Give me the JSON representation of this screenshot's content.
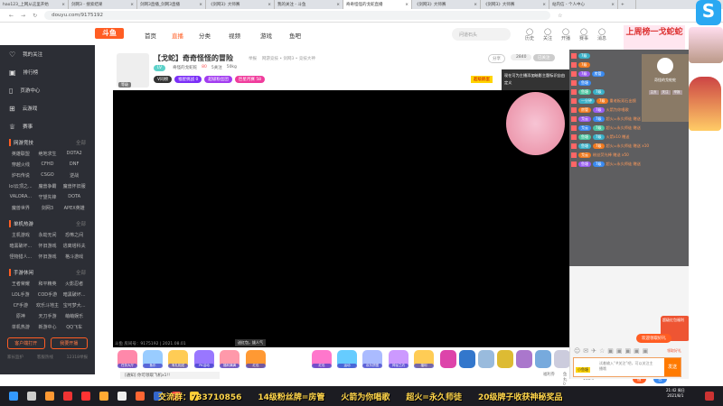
{
  "browser": {
    "tabs": [
      "hao123_上网从这里开始",
      "剑网3 - 搜索结果",
      "剑网3直播_剑网3直播",
      "《剑网3》大师赛",
      "我的关注 - 斗鱼",
      "奇奇怪怪的戈蛇直播",
      "《剑网3》大师赛",
      "《剑网3》大师赛",
      "站内信 - 个人中心"
    ],
    "new_tab": "+",
    "url": "douyu.com/9175192"
  },
  "site": {
    "logo": "斗鱼",
    "nav": [
      "首页",
      "直播",
      "分类",
      "视频",
      "游戏",
      "鱼吧"
    ],
    "search_placeholder": "问道石头",
    "top_icons": [
      "历史",
      "关注",
      "开播",
      "赛事",
      "消息"
    ]
  },
  "sidebar": {
    "items": [
      "我的关注",
      "排行榜",
      "页游中心",
      "云游戏",
      "赛事"
    ],
    "sections": [
      {
        "title": "网游竞技",
        "more": "全部",
        "games": [
          "英雄联盟",
          "绝地求生",
          "DOTA2",
          "穿越火线",
          "CFHD",
          "DNF",
          "炉石传说",
          "CSGO",
          "逆战",
          "lol云顶之...",
          "魔兽争霸",
          "魔兽怀旧服",
          "VALORA...",
          "守望先锋",
          "DOTA",
          "魔兽世界",
          "剑网3",
          "APEX英雄"
        ]
      },
      {
        "title": "单机热游",
        "more": "全部",
        "games": [
          "主机游戏",
          "永劫无间",
          "恐怖之间",
          "暗黑破坏...",
          "怀旧游戏",
          "逃离塔科夫",
          "怪物猎人...",
          "怀旧游戏",
          "格斗游戏"
        ]
      },
      {
        "title": "手游休闲",
        "more": "全部",
        "games": [
          "王者荣耀",
          "和平精英",
          "火影忍者",
          "LOL手游",
          "COD手游",
          "暗黑破坏...",
          "CF手游",
          "欢乐斗地主",
          "宝可梦大...",
          "原神",
          "天刀手游",
          "萌萌娱乐",
          "单机热游",
          "新游中心",
          "QQ飞车"
        ]
      }
    ],
    "buttons": [
      "客户端打开",
      "我要开播"
    ],
    "footer": [
      "家长监护",
      "客服热线",
      "12318举报"
    ]
  },
  "room": {
    "title": "【戈蛇】奇奇怪怪的冒险",
    "tag": "举报",
    "category": "网游竞技 • 剑网3 • 竞技大神",
    "level": "LV",
    "streamer": "奇怪的戈蛇蛇",
    "heat": "80",
    "followers": "5关注",
    "weight": "50kg",
    "avatar_label": "等级",
    "pills": [
      "V同榜",
      "福星挑战 0",
      "超级粉丝团",
      "巨星月赛 58"
    ],
    "share": "分享",
    "follow_count": "2840",
    "follow_btn": "已关注",
    "badge": "超级鹅蛋",
    "tooltip": "现在可为主播添加暗影主题标识自由定义"
  },
  "video": {
    "watermark": "斗鱼 房间号：9175192 | 2021.08.01"
  },
  "gifts": {
    "tooltip": "送红包，拔人气",
    "items": [
      "任务大厅",
      "鱼乐",
      "有礼相送",
      "PK活动",
      "福利满满",
      "红包",
      "红包",
      "运动",
      "欢乐拼图",
      "神龙之约",
      "福利"
    ],
    "notice": "[通知] 你可领取飞机x1!!",
    "stats": [
      "福利券",
      "鱼丸 0",
      "鱼翅 148.9"
    ],
    "recharge": "充值",
    "backpack": "背包"
  },
  "chat": {
    "lines": [
      {
        "badges": [
          "7级"
        ],
        "text": ""
      },
      {
        "badges": [
          "7级"
        ],
        "text": ""
      },
      {
        "badges": [
          "7级",
          "房管"
        ],
        "text": ""
      },
      {
        "badges": [
          "鱼塘"
        ],
        "text": ""
      },
      {
        "badges": [
          "鱼塘",
          "7级"
        ],
        "text": ""
      },
      {
        "badges": [
          "一分钟",
          "7级"
        ],
        "text": "重老板双石出镜"
      },
      {
        "badges": [
          "房管",
          "7级"
        ],
        "text": "火箭为你唱歌"
      },
      {
        "badges": [
          "戈云",
          "7级"
        ],
        "text": "超火=永久师徒 赠送"
      },
      {
        "badges": [
          "戈云",
          "7级"
        ],
        "text": "超火=永久师徒 赠送"
      },
      {
        "badges": [
          "鱼塘",
          "7级"
        ],
        "text": "火箭x10 赠送"
      },
      {
        "badges": [
          "鱼塘",
          "7级"
        ],
        "text": "超火=永久师徒 赠送 x10"
      },
      {
        "badges": [
          "戈云"
        ],
        "text": "粉丝荧光棒 赠送 x50"
      },
      {
        "badges": [
          "鱼塘",
          "7级"
        ],
        "text": "超火=永久师徒 赠送"
      }
    ],
    "card_name": "奇怪的戈蛇蛇",
    "card_buttons": [
      "主页",
      "关注",
      "举报"
    ],
    "redpack_banner": "超级红包福利",
    "redpack_tip": "欢迎领取好礼",
    "input_placeholder": "试着输入“#关注”吧，可以关注主播哦",
    "send": "发送",
    "fan_badge": "小鱼塘",
    "promo": "领取好礼"
  },
  "promo": {
    "banner": "上周榜一戈蛇蛇"
  },
  "taskbar": {
    "subtitle": "交流群：733710856　　14级粉丝牌=房管　　火箭为你唱歌　　超火=永久师徒　　20级牌子收获神秘奖品",
    "time": "21:42 周日",
    "date": "2021/8/1"
  },
  "colors": {
    "accent": "#ff5d23",
    "sidebar": "#2c2e35",
    "chat": "#5e5e60"
  }
}
